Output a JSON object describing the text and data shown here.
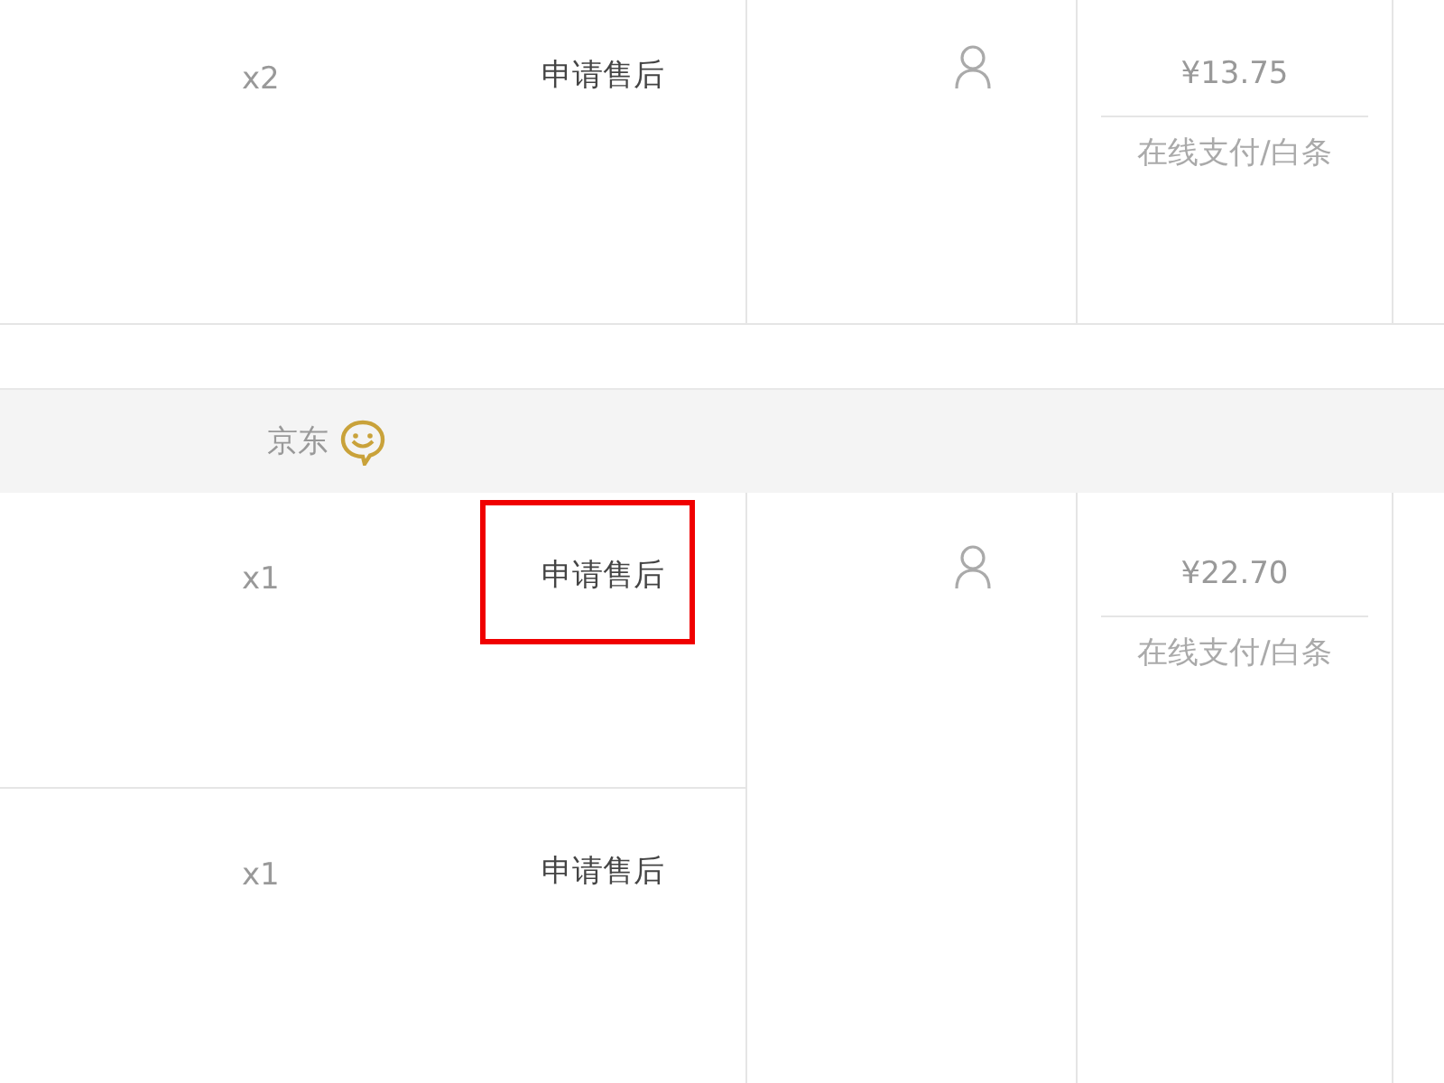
{
  "orders": [
    {
      "items": [
        {
          "quantity": "x2",
          "action": {
            "label": "申请售后",
            "highlighted": false
          }
        }
      ],
      "price": "¥13.75",
      "payment": "在线支付/白条"
    },
    {
      "shop": "京东",
      "items": [
        {
          "quantity": "x1",
          "action": {
            "label": "申请售后",
            "highlighted": true
          }
        },
        {
          "quantity": "x1",
          "action": {
            "label": "申请售后",
            "highlighted": false
          }
        }
      ],
      "price": "¥22.70",
      "payment": "在线支付/白条"
    }
  ]
}
